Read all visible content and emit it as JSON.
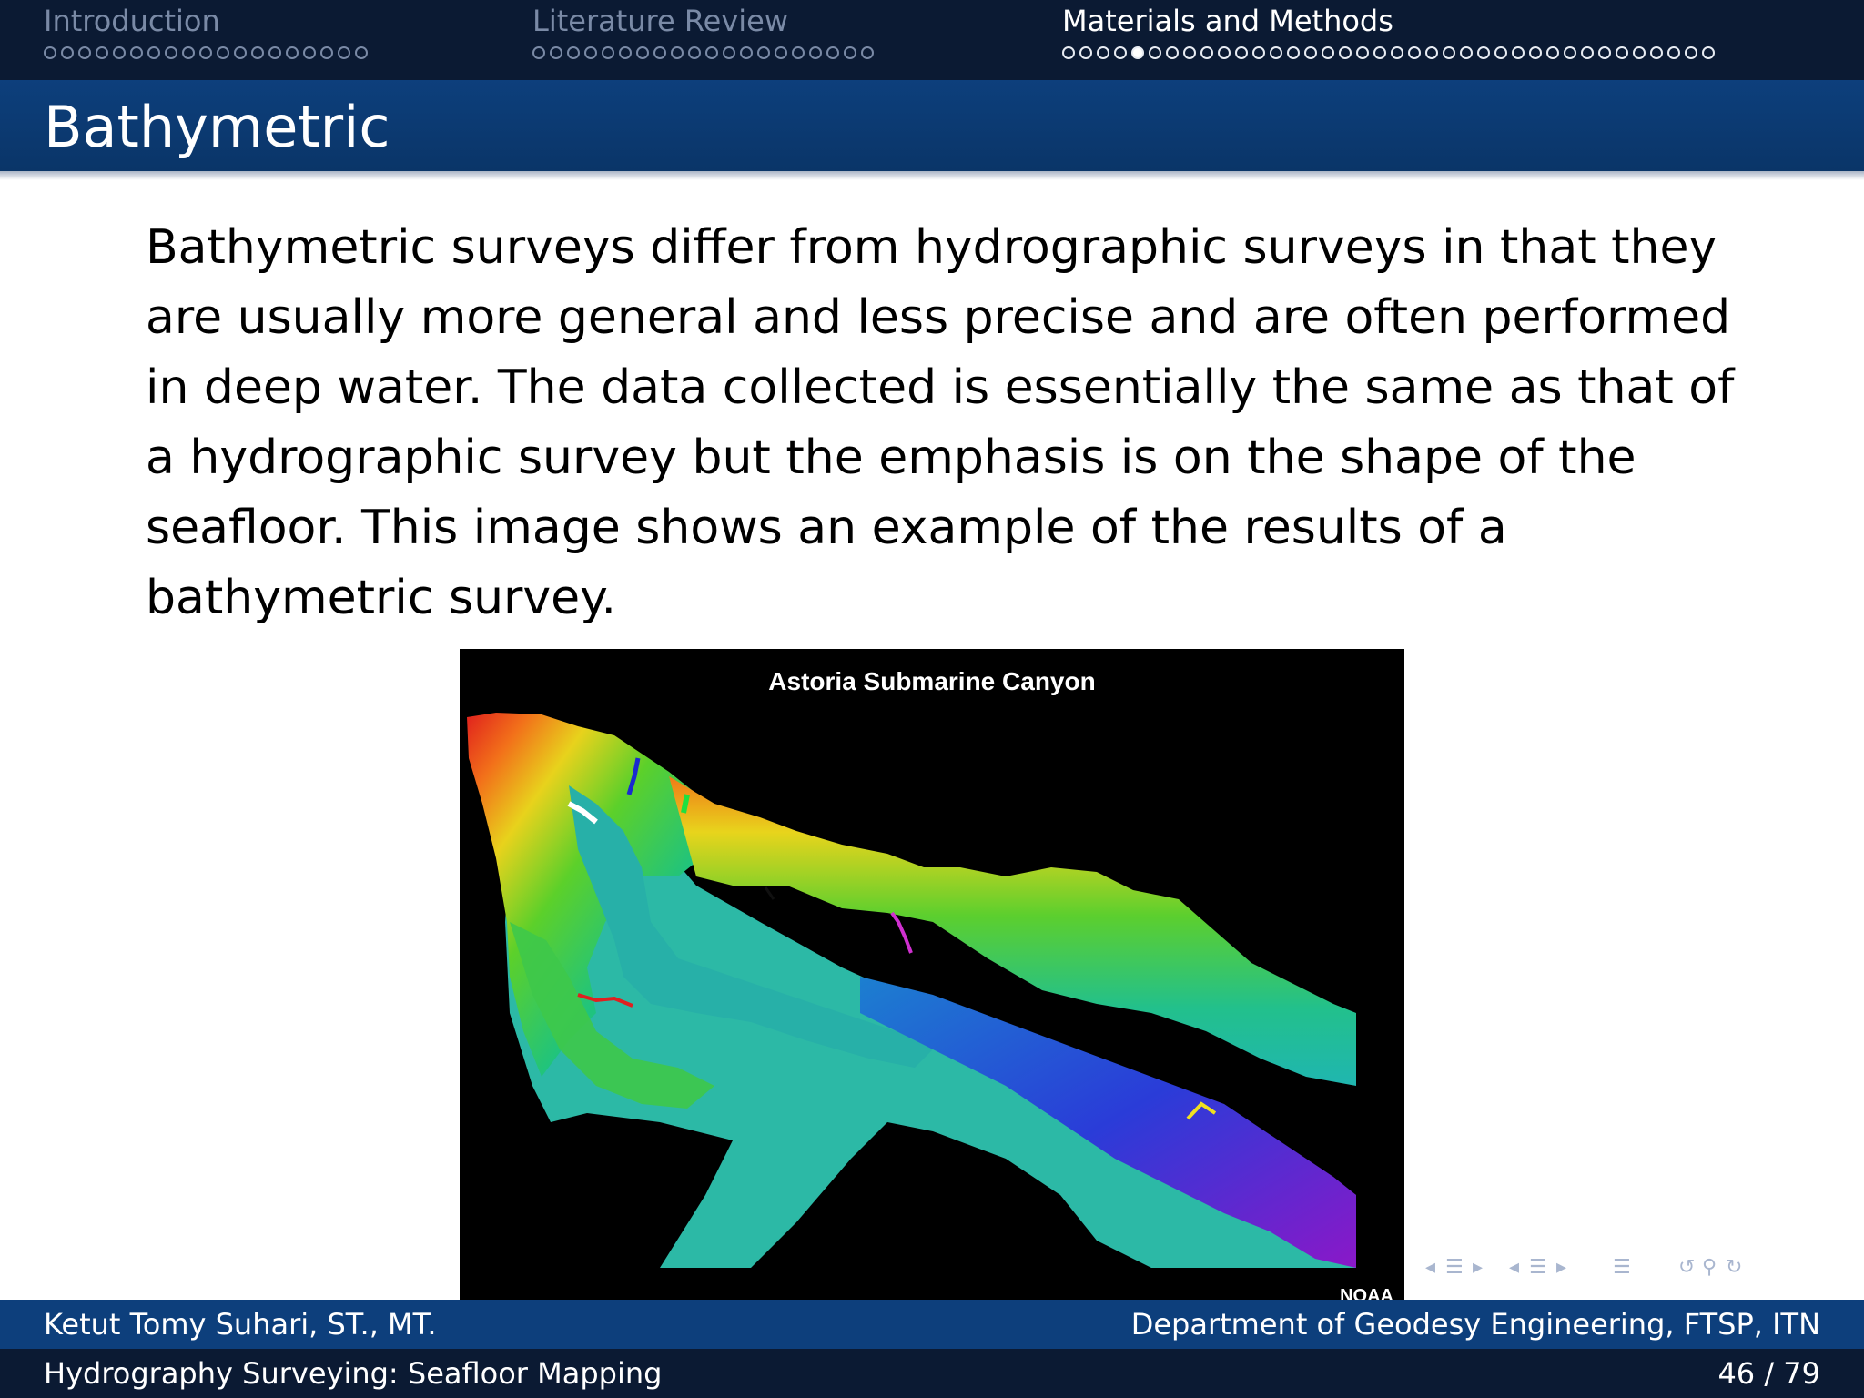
{
  "nav": {
    "sections": [
      {
        "title": "Introduction",
        "dots": 19,
        "current": -1,
        "active": false
      },
      {
        "title": "Literature Review",
        "dots": 20,
        "current": -1,
        "active": false
      },
      {
        "title": "Materials and Methods",
        "dots": 38,
        "current": 4,
        "active": true
      }
    ]
  },
  "frame": {
    "title": "Bathymetric",
    "paragraph_lines": [
      "Bathymetric surveys differ from hydrographic surveys in that they",
      "are usually more general and less precise and are often performed",
      "in deep water.  The data collected is essentially the same as that of",
      "a hydrographic survey but the emphasis is on the shape of the",
      "seafloor.  This image shows an example of the results of a",
      "bathymetric survey."
    ]
  },
  "figure": {
    "title": "Astoria Submarine Canyon",
    "credit": "NOAA"
  },
  "footer": {
    "author": "Ketut Tomy Suhari, ST., MT.",
    "institution": "Department of Geodesy Engineering, FTSP, ITN",
    "talk_title": "Hydrography Surveying: Seafloor Mapping",
    "page": "46 / 79"
  },
  "colors": {
    "nav_bg": "#0b1a33",
    "title_bg": "#0d3f7c",
    "footer_top_bg": "#0d3f7c",
    "footer_bottom_bg": "#0b1a33"
  }
}
